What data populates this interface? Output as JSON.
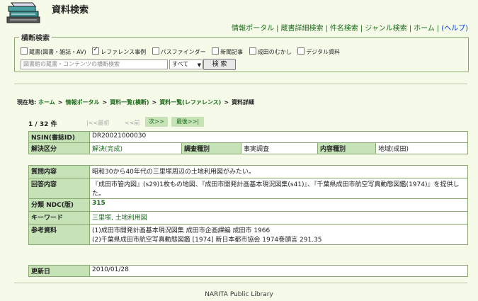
{
  "header": {
    "title": "資料検索",
    "nav": [
      "情報ポータル",
      "蔵書詳細検索",
      "件名検索",
      "ジャンル検索",
      "ホーム"
    ],
    "help": "(ヘルプ)"
  },
  "cross_search": {
    "legend": "横断検索",
    "checkboxes": [
      {
        "label": "蔵書(図書・雑誌・AV)",
        "checked": false
      },
      {
        "label": "レファレンス事例",
        "checked": true
      },
      {
        "label": "パスファインダー",
        "checked": false
      },
      {
        "label": "新聞記事",
        "checked": false
      },
      {
        "label": "成田のむかし",
        "checked": false
      },
      {
        "label": "デジタル資料",
        "checked": false
      }
    ],
    "placeholder": "図書館の蔵書・コンテンツの横断検索",
    "scope_selected": "すべて",
    "search_button": "検 索"
  },
  "breadcrumb": {
    "here": "現在地:",
    "items": [
      "ホーム",
      "情報ポータル",
      "資料一覧(横断)",
      "資料一覧(レファレンス)"
    ],
    "current": "資料詳細"
  },
  "pager": {
    "count": "1 / 32 件",
    "first": "|<<最初",
    "prev": "<<前",
    "next": "次>>",
    "last": "最後>>|"
  },
  "record": {
    "nsin_label": "NSIN(書誌ID)",
    "nsin_value": "DR20021000030",
    "solved_label": "解決区分",
    "solved_value": "解決(完成)",
    "survey_label": "調査種別",
    "survey_value": "事実調査",
    "content_label": "内容種別",
    "content_value": "地域(成田)",
    "question_label": "質問内容",
    "question_value": "昭和30から40年代の三里塚周辺の土地利用図がみたい。",
    "answer_label": "回答内容",
    "answer_value": "『成田市管内図』(s29)1枚もの地図、『成田市開発計画基本現況図集(s41)』、『千葉県成田市航空写真動態図鑑(1974)』を提供した。",
    "ndc_label": "分類 NDC(版)",
    "ndc_value": "315",
    "keyword_label": "キーワード",
    "keyword_value": "三里塚, 土地利用図",
    "ref_label": "参考資料",
    "ref_lines": [
      "(1)成田市開発計画基本現況図集 成田市企画課編 成田市 1966",
      "(2)千葉県成田市航空写真動態図鑑 [1974] 新日本都市協会 1974巻頭言 291.35"
    ],
    "updated_label": "更新日",
    "updated_value": "2010/01/28"
  },
  "footer": "NARITA Public Library"
}
